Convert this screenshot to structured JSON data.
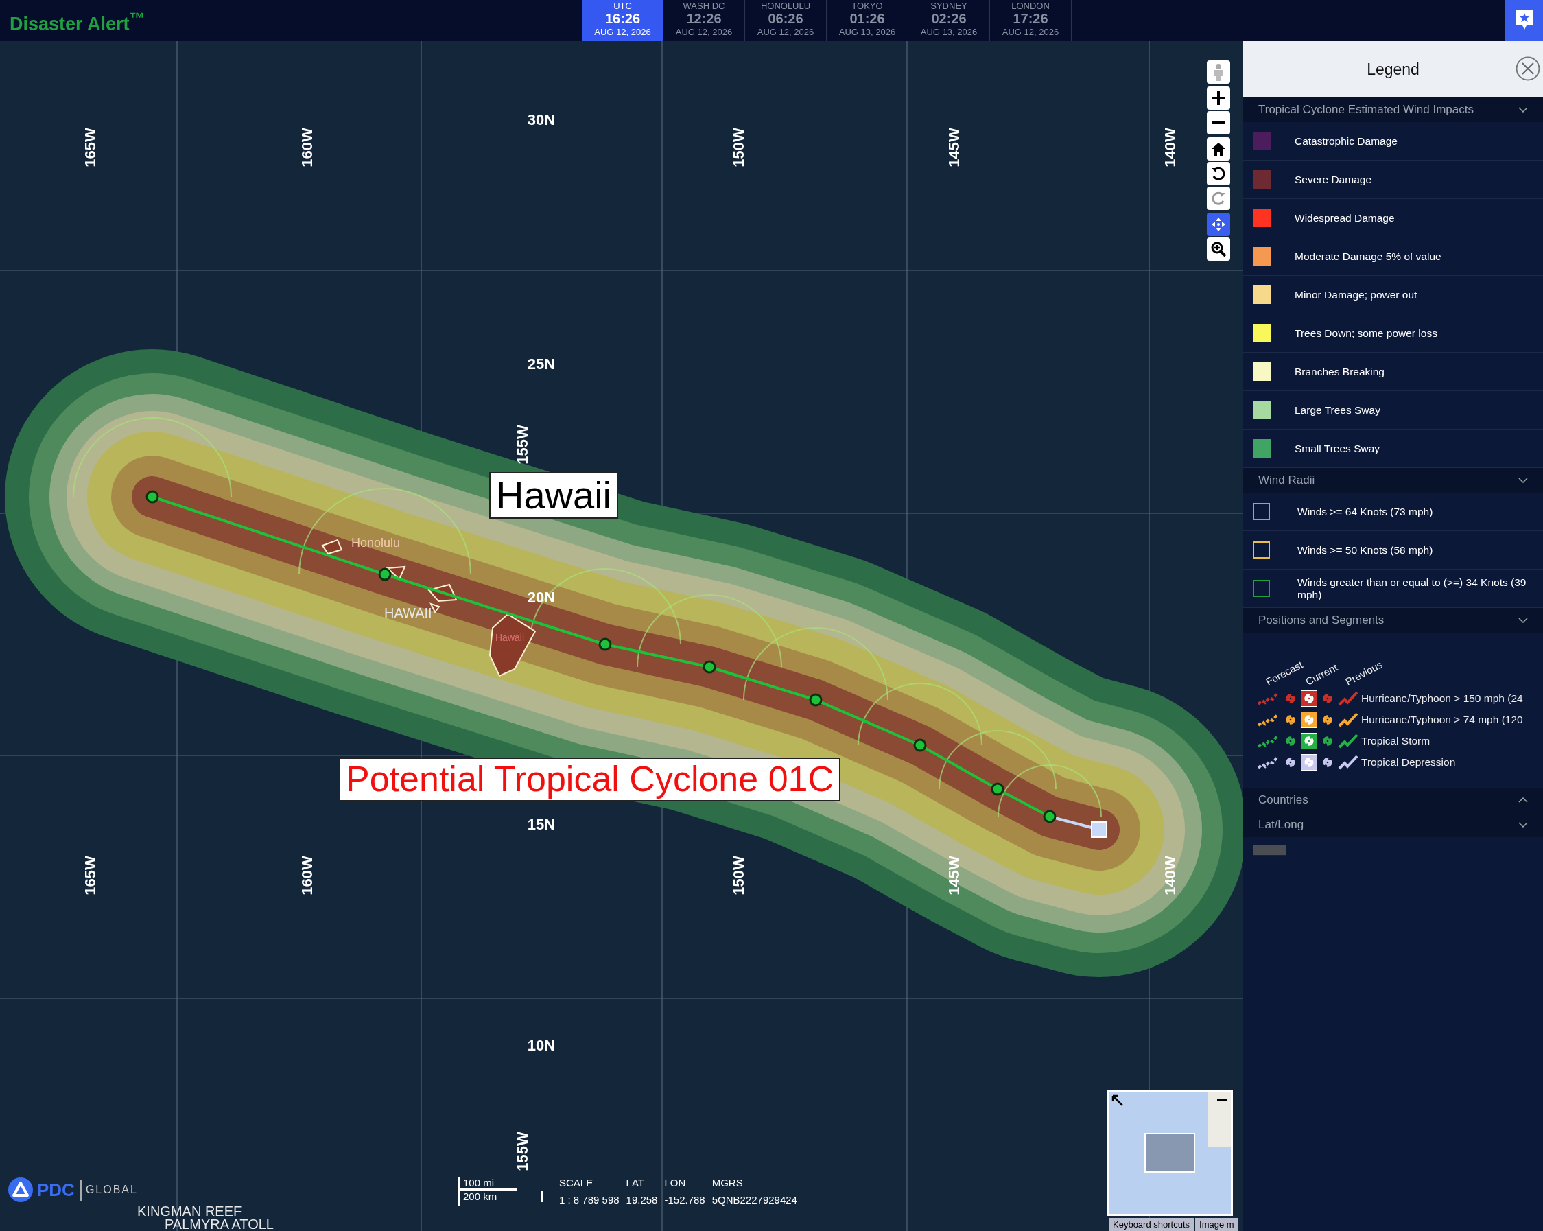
{
  "header": {
    "logo": "Disaster Alert$^{™}$",
    "clocks": [
      {
        "city": "UTC",
        "time": "16:26",
        "date": "AUG 12, 2026",
        "selected": true
      },
      {
        "city": "WASH DC",
        "time": "12:26",
        "date": "AUG 12, 2026",
        "selected": false
      },
      {
        "city": "HONOLULU",
        "time": "06:26",
        "date": "AUG 12, 2026",
        "selected": false
      },
      {
        "city": "TOKYO",
        "time": "01:26",
        "date": "AUG 13, 2026",
        "selected": false
      },
      {
        "city": "SYDNEY",
        "time": "02:26",
        "date": "AUG 13, 2026",
        "selected": false
      },
      {
        "city": "LONDON",
        "time": "17:26",
        "date": "AUG 12, 2026",
        "selected": false
      }
    ]
  },
  "map": {
    "grid_labels": [
      {
        "text": "30N",
        "kind": "lat"
      },
      {
        "text": "25N",
        "kind": "lat"
      },
      {
        "text": "20N",
        "kind": "lat"
      },
      {
        "text": "15N",
        "kind": "lat"
      },
      {
        "text": "10N",
        "kind": "lat"
      },
      {
        "text": "165W",
        "kind": "lon"
      },
      {
        "text": "160W",
        "kind": "lon"
      },
      {
        "text": "150W",
        "kind": "lon"
      },
      {
        "text": "145W",
        "kind": "lon"
      },
      {
        "text": "140W",
        "kind": "lon"
      },
      {
        "text": "155W",
        "kind": "lon"
      },
      {
        "text": "165W",
        "kind": "lon"
      },
      {
        "text": "160W",
        "kind": "lon"
      },
      {
        "text": "150W",
        "kind": "lon"
      },
      {
        "text": "145W",
        "kind": "lon"
      },
      {
        "text": "140W",
        "kind": "lon"
      },
      {
        "text": "155W",
        "kind": "lon"
      }
    ],
    "place_labels": [
      {
        "text": "Honolulu",
        "kind": "city"
      },
      {
        "text": "HAWAII",
        "kind": "region"
      },
      {
        "text": "Hawaii",
        "kind": "island"
      },
      {
        "text": "KINGMAN REEF",
        "kind": "region"
      },
      {
        "text": "PALMYRA ATOLL",
        "kind": "region"
      }
    ],
    "callouts": [
      {
        "text": "Hawaii",
        "kind": "place"
      },
      {
        "text": "Potential Tropical Cyclone 01C",
        "kind": "storm"
      }
    ],
    "brand": {
      "name": "PDC",
      "tagline": "GLOBAL"
    },
    "scale": {
      "miles": "100 mi",
      "km": "200 km"
    },
    "readout": [
      {
        "label": "SCALE",
        "value": "1 : 8 789 598"
      },
      {
        "label": "LAT",
        "value": "19.258"
      },
      {
        "label": "LON",
        "value": "-152.788"
      },
      {
        "label": "MGRS",
        "value": "5QNB2227929424"
      }
    ],
    "footer_buttons": [
      "Keyboard shortcuts",
      "Image m"
    ]
  },
  "legend": {
    "title": "Legend",
    "sections": [
      {
        "title": "Tropical Cyclone Estimated Wind Impacts",
        "kind": "swatches",
        "expanded": true,
        "items": [
          {
            "label": "Catastrophic Damage",
            "color": "#4c1d5c"
          },
          {
            "label": "Severe Damage",
            "color": "#6e2a32"
          },
          {
            "label": "Widespread Damage",
            "color": "#ff3322"
          },
          {
            "label": "Moderate Damage 5% of value",
            "color": "#f59850"
          },
          {
            "label": "Minor Damage; power out",
            "color": "#f7d98c"
          },
          {
            "label": "Trees Down; some power loss",
            "color": "#f8f85a"
          },
          {
            "label": "Branches Breaking",
            "color": "#f8f8c4"
          },
          {
            "label": "Large Trees Sway",
            "color": "#a6daa0"
          },
          {
            "label": "Small Trees Sway",
            "color": "#3fa464"
          }
        ]
      },
      {
        "title": "Wind Radii",
        "kind": "outlines",
        "expanded": true,
        "items": [
          {
            "label": "Winds >= 64 Knots (73 mph)",
            "color": "#f0902a"
          },
          {
            "label": "Winds >= 50 Knots (58 mph)",
            "color": "#e8c048"
          },
          {
            "label": "Winds greater than or equal to (>=) 34 Knots (39 mph)",
            "color": "#20a040"
          }
        ]
      },
      {
        "title": "Positions and Segments",
        "kind": "positions",
        "expanded": true,
        "columns": [
          "Forecast",
          "Current",
          "Previous"
        ],
        "items": [
          {
            "label": "Hurricane/Typhoon > 150 mph (24",
            "color": "#c8302a"
          },
          {
            "label": "Hurricane/Typhoon > 74 mph (120",
            "color": "#f8a830"
          },
          {
            "label": "Tropical Storm",
            "color": "#28b048"
          },
          {
            "label": "Tropical Depression",
            "color": "#c8c8f0"
          }
        ]
      },
      {
        "title": "Countries",
        "expanded": false
      },
      {
        "title": "Lat/Long",
        "kind": "line",
        "expanded": true
      }
    ]
  }
}
